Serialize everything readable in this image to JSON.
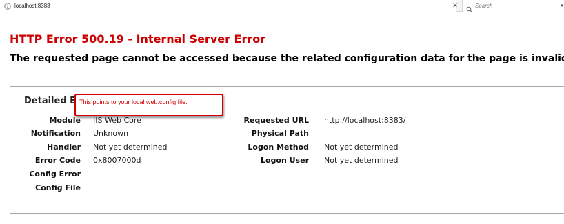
{
  "browser": {
    "url": "localhost:8383",
    "close_glyph": "✕",
    "search_placeholder": "Search",
    "menu_glyph": "▾"
  },
  "error": {
    "title": "HTTP Error 500.19 - Internal Server Error",
    "subtitle": "The requested page cannot be accessed because the related configuration data for the page is invalid."
  },
  "details": {
    "heading": "Detailed Error Information:",
    "left": [
      {
        "label": "Module",
        "value": "IIS Web Core"
      },
      {
        "label": "Notification",
        "value": "Unknown"
      },
      {
        "label": "Handler",
        "value": "Not yet determined"
      },
      {
        "label": "Error Code",
        "value": "0x8007000d"
      },
      {
        "label": "Config Error",
        "value": ""
      },
      {
        "label": "Config File",
        "value": ""
      }
    ],
    "right": [
      {
        "label": "Requested URL",
        "value": "http://localhost:8383/"
      },
      {
        "label": "Physical Path",
        "value": ""
      },
      {
        "label": "Logon Method",
        "value": "Not yet determined"
      },
      {
        "label": "Logon User",
        "value": "Not yet determined"
      }
    ]
  },
  "annotation": {
    "text": "This points to your local web.config file."
  },
  "colors": {
    "error_red": "#cc0000",
    "annotation_border": "#d40000"
  }
}
